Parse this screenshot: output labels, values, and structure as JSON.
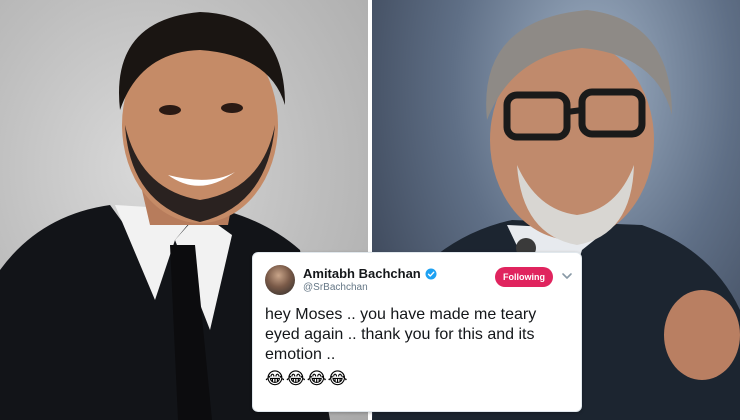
{
  "tweet": {
    "display_name": "Amitabh Bachchan",
    "handle": "@SrBachchan",
    "follow_label": "Following",
    "text": "hey Moses .. you have made me teary eyed again .. thank you for this and its emotion ..",
    "emojis": "😂😂😂😂",
    "verified_icon": "verified-badge-icon",
    "menu_icon": "chevron-down-icon"
  },
  "colors": {
    "follow_button": "#e0245e",
    "verified": "#1da1f2",
    "text": "#14171a",
    "muted": "#657786"
  }
}
